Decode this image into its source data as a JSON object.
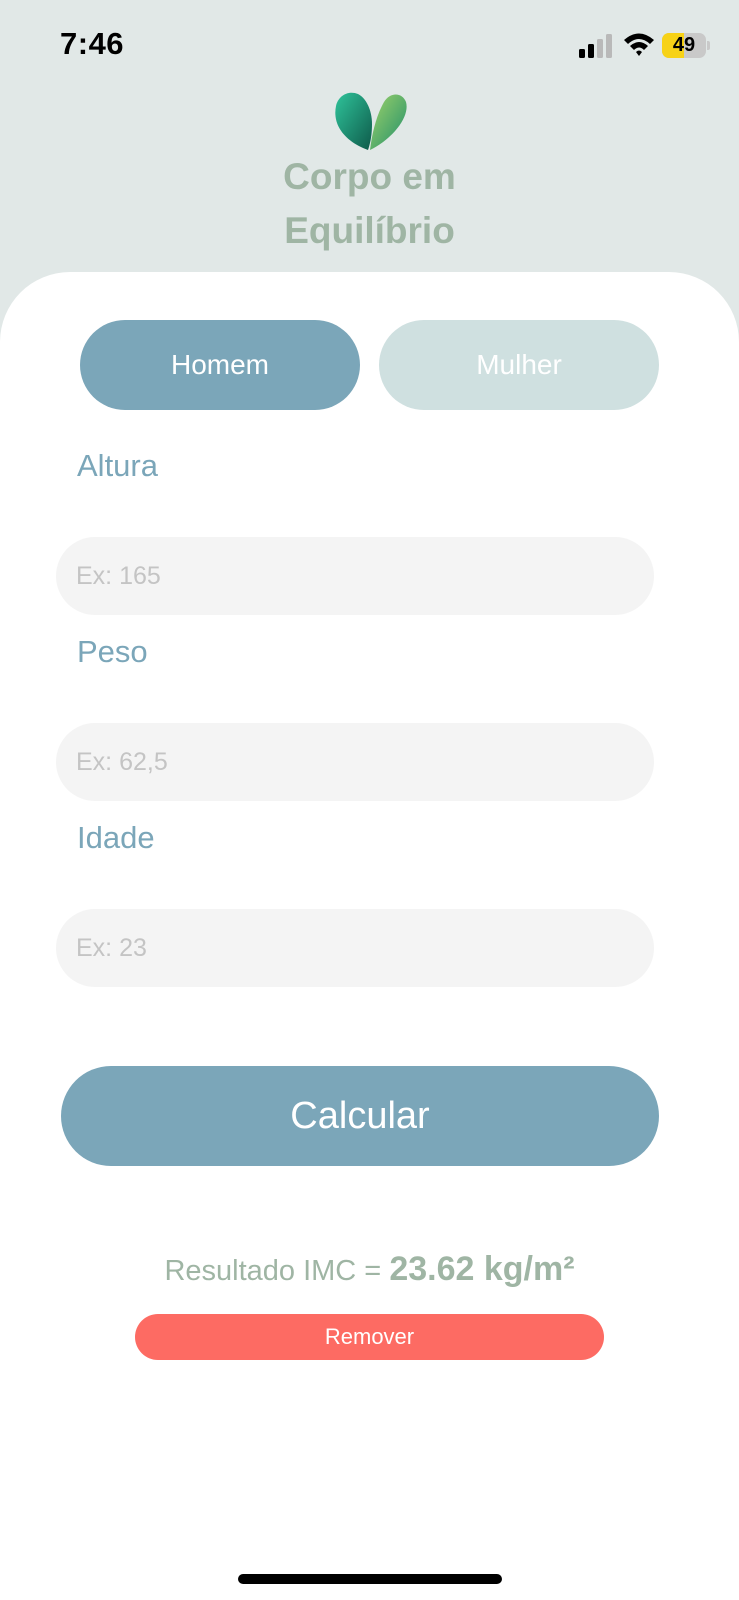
{
  "status_bar": {
    "time": "7:46",
    "battery_level": "49",
    "battery_fraction": 0.49,
    "signal_icon": "cellular-signal-icon",
    "wifi_icon": "wifi-icon",
    "battery_color": "#f7d217"
  },
  "header": {
    "logo_icon": "leaf-heart-icon",
    "title_line1": "Corpo em",
    "title_line2": "Equilíbrio",
    "title_color": "#9fb5a4"
  },
  "gender": {
    "male_label": "Homem",
    "female_label": "Mulher",
    "selected": "Homem",
    "selected_color": "#7ba6b9",
    "unselected_color": "#cfe0e0"
  },
  "fields": {
    "height": {
      "label": "Altura",
      "placeholder": "Ex: 165",
      "value": ""
    },
    "weight": {
      "label": "Peso",
      "placeholder": "Ex: 62,5",
      "value": ""
    },
    "age": {
      "label": "Idade",
      "placeholder": "Ex: 23",
      "value": ""
    }
  },
  "actions": {
    "calculate_label": "Calcular",
    "remove_label": "Remover",
    "remove_color": "#fd6b63"
  },
  "result": {
    "prefix": "Resultado IMC = ",
    "value": "23.62 kg/m²"
  }
}
